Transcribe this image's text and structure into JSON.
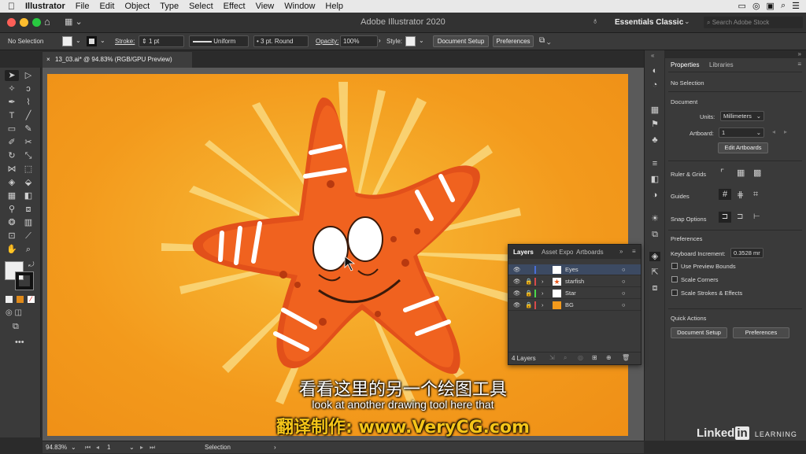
{
  "menubar": {
    "app": "Illustrator",
    "items": [
      "File",
      "Edit",
      "Object",
      "Type",
      "Select",
      "Effect",
      "View",
      "Window",
      "Help"
    ]
  },
  "appbar": {
    "title": "Adobe Illustrator 2020",
    "workspace": "Essentials Classic",
    "search_placeholder": "Search Adobe Stock"
  },
  "control_bar": {
    "selection": "No Selection",
    "stroke_label": "Stroke:",
    "stroke_value": "1 pt",
    "profile": "Uniform",
    "brush": "3 pt. Round",
    "opacity_label": "Opacity:",
    "opacity_value": "100%",
    "style_label": "Style:",
    "document_setup": "Document Setup",
    "preferences": "Preferences"
  },
  "document": {
    "tab_title": "13_03.ai* @ 94.83% (RGB/GPU Preview)"
  },
  "properties_panel": {
    "tabs": [
      "Properties",
      "Libraries"
    ],
    "selection": "No Selection",
    "document_heading": "Document",
    "units_label": "Units:",
    "units_value": "Millimeters",
    "artboard_label": "Artboard:",
    "artboard_value": "1",
    "edit_artboards": "Edit Artboards",
    "ruler_grids": "Ruler & Grids",
    "guides": "Guides",
    "snap_options": "Snap Options",
    "preferences_heading": "Preferences",
    "keyboard_increment_label": "Keyboard Increment:",
    "keyboard_increment_value": "0.3528 mr",
    "checkboxes": [
      "Use Preview Bounds",
      "Scale Corners",
      "Scale Strokes & Effects"
    ],
    "quick_actions": "Quick Actions",
    "document_setup_btn": "Document Setup",
    "preferences_btn": "Preferences"
  },
  "layers_panel": {
    "tabs": [
      "Layers",
      "Asset Expo",
      "Artboards"
    ],
    "layers": [
      {
        "name": "Eyes",
        "color": "#4a6fd8"
      },
      {
        "name": "starfish",
        "color": "#d84a4a"
      },
      {
        "name": "Star",
        "color": "#4ad84a"
      },
      {
        "name": "BG",
        "color": "#d84a4a"
      }
    ],
    "count": "4 Layers"
  },
  "status_bar": {
    "zoom": "94.83%",
    "artboard": "1",
    "tool": "Selection"
  },
  "subtitles": {
    "chinese": "看看这里的另一个绘图工具",
    "english": "look at another drawing tool here that",
    "credit": "翻译制作: www.VeryCG.com"
  },
  "watermark": {
    "brand": "Linked",
    "in": "in",
    "learning": "LEARNING"
  },
  "colors": {
    "starfish": "#ef5a1a",
    "background": "#f39a1c",
    "credit_yellow": "#f5c518"
  }
}
